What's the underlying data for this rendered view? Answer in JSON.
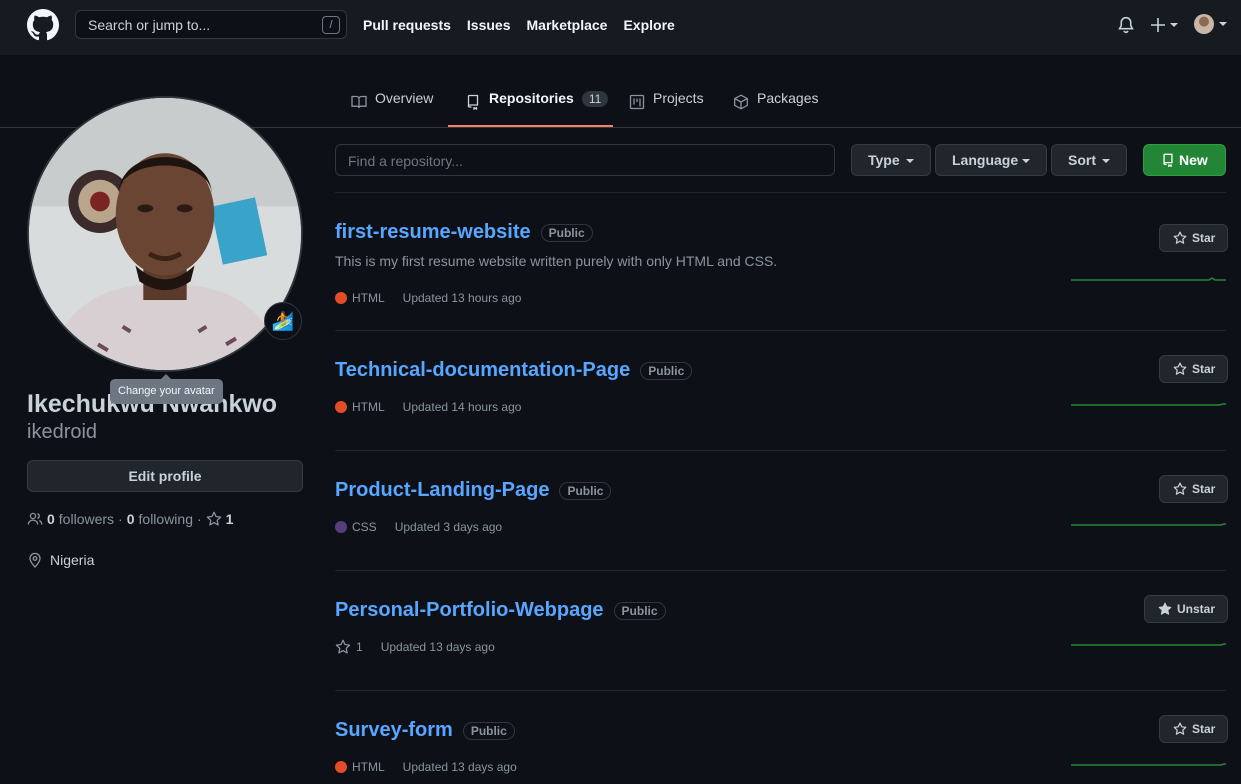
{
  "header": {
    "search_placeholder": "Search or jump to...",
    "search_shortcut": "/",
    "nav": [
      "Pull requests",
      "Issues",
      "Marketplace",
      "Explore"
    ]
  },
  "tabs": [
    {
      "label": "Overview"
    },
    {
      "label": "Repositories",
      "count": "11",
      "active": true
    },
    {
      "label": "Projects"
    },
    {
      "label": "Packages"
    }
  ],
  "profile": {
    "tooltip": "Change your avatar",
    "status_emoji": "🏄",
    "full_name": "Ikechukwu Nwankwo",
    "username": "ikedroid",
    "edit_label": "Edit profile",
    "followers_count": "0",
    "followers_label": "followers",
    "separator": "·",
    "following_count": "0",
    "following_label": "following",
    "stars_count": "1",
    "location": "Nigeria"
  },
  "filters": {
    "find_placeholder": "Find a repository...",
    "type_label": "Type",
    "language_label": "Language",
    "sort_label": "Sort",
    "new_label": "New"
  },
  "repos": [
    {
      "name": "first-resume-website",
      "visibility": "Public",
      "description": "This is my first resume website written purely with only HTML and CSS.",
      "language": "HTML",
      "lang_color": "#e34c26",
      "updated": "Updated 13 hours ago",
      "star_label": "Star"
    },
    {
      "name": "Technical-documentation-Page",
      "visibility": "Public",
      "language": "HTML",
      "lang_color": "#e34c26",
      "updated": "Updated 14 hours ago",
      "star_label": "Star"
    },
    {
      "name": "Product-Landing-Page",
      "visibility": "Public",
      "language": "CSS",
      "lang_color": "#563d7c",
      "updated": "Updated 3 days ago",
      "star_label": "Star"
    },
    {
      "name": "Personal-Portfolio-Webpage",
      "visibility": "Public",
      "stars": "1",
      "updated": "Updated 13 days ago",
      "star_label": "Unstar"
    },
    {
      "name": "Survey-form",
      "visibility": "Public",
      "language": "HTML",
      "lang_color": "#e34c26",
      "updated": "Updated 13 days ago",
      "star_label": "Star"
    }
  ],
  "colors": {
    "accent": "#58a6ff",
    "tab_underline": "#f78166",
    "new_button": "#238636",
    "activity": "#238636"
  }
}
